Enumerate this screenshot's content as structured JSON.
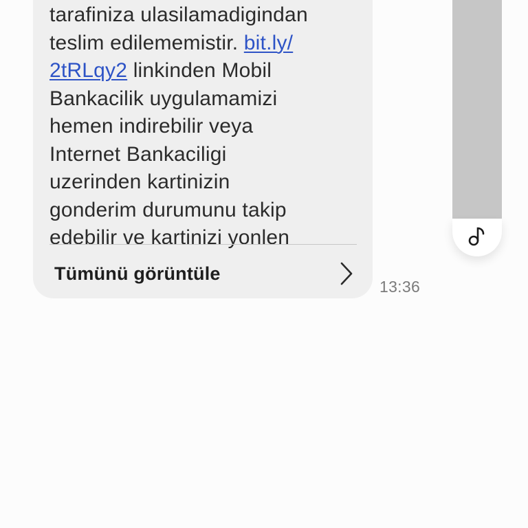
{
  "message": {
    "lines": [
      "tarafiniza ulasilamadigindan",
      "teslim edilememistir. ",
      "linkinden Mobil",
      "Bankacilik uygulamamizi",
      "hemen indirebilir veya",
      "Internet Bankaciligi",
      "uzerinden kartinizin",
      "gonderim durumunu takip",
      "edebilir ve kartinizi yonlen"
    ],
    "link_part1": "bit.ly/",
    "link_part2": "2tRLqy2",
    "view_all_label": "Tümünü görüntüle",
    "timestamp": "13:36"
  },
  "colors": {
    "bubble": "#efefef",
    "link": "#2d53c6",
    "text": "#2b2b2b",
    "timestamp": "#7b7b7b",
    "scroll_track": "#c6c6c6"
  },
  "icons": {
    "view_all": "chevron-right-icon",
    "scroll_handle": "music-note-icon"
  }
}
